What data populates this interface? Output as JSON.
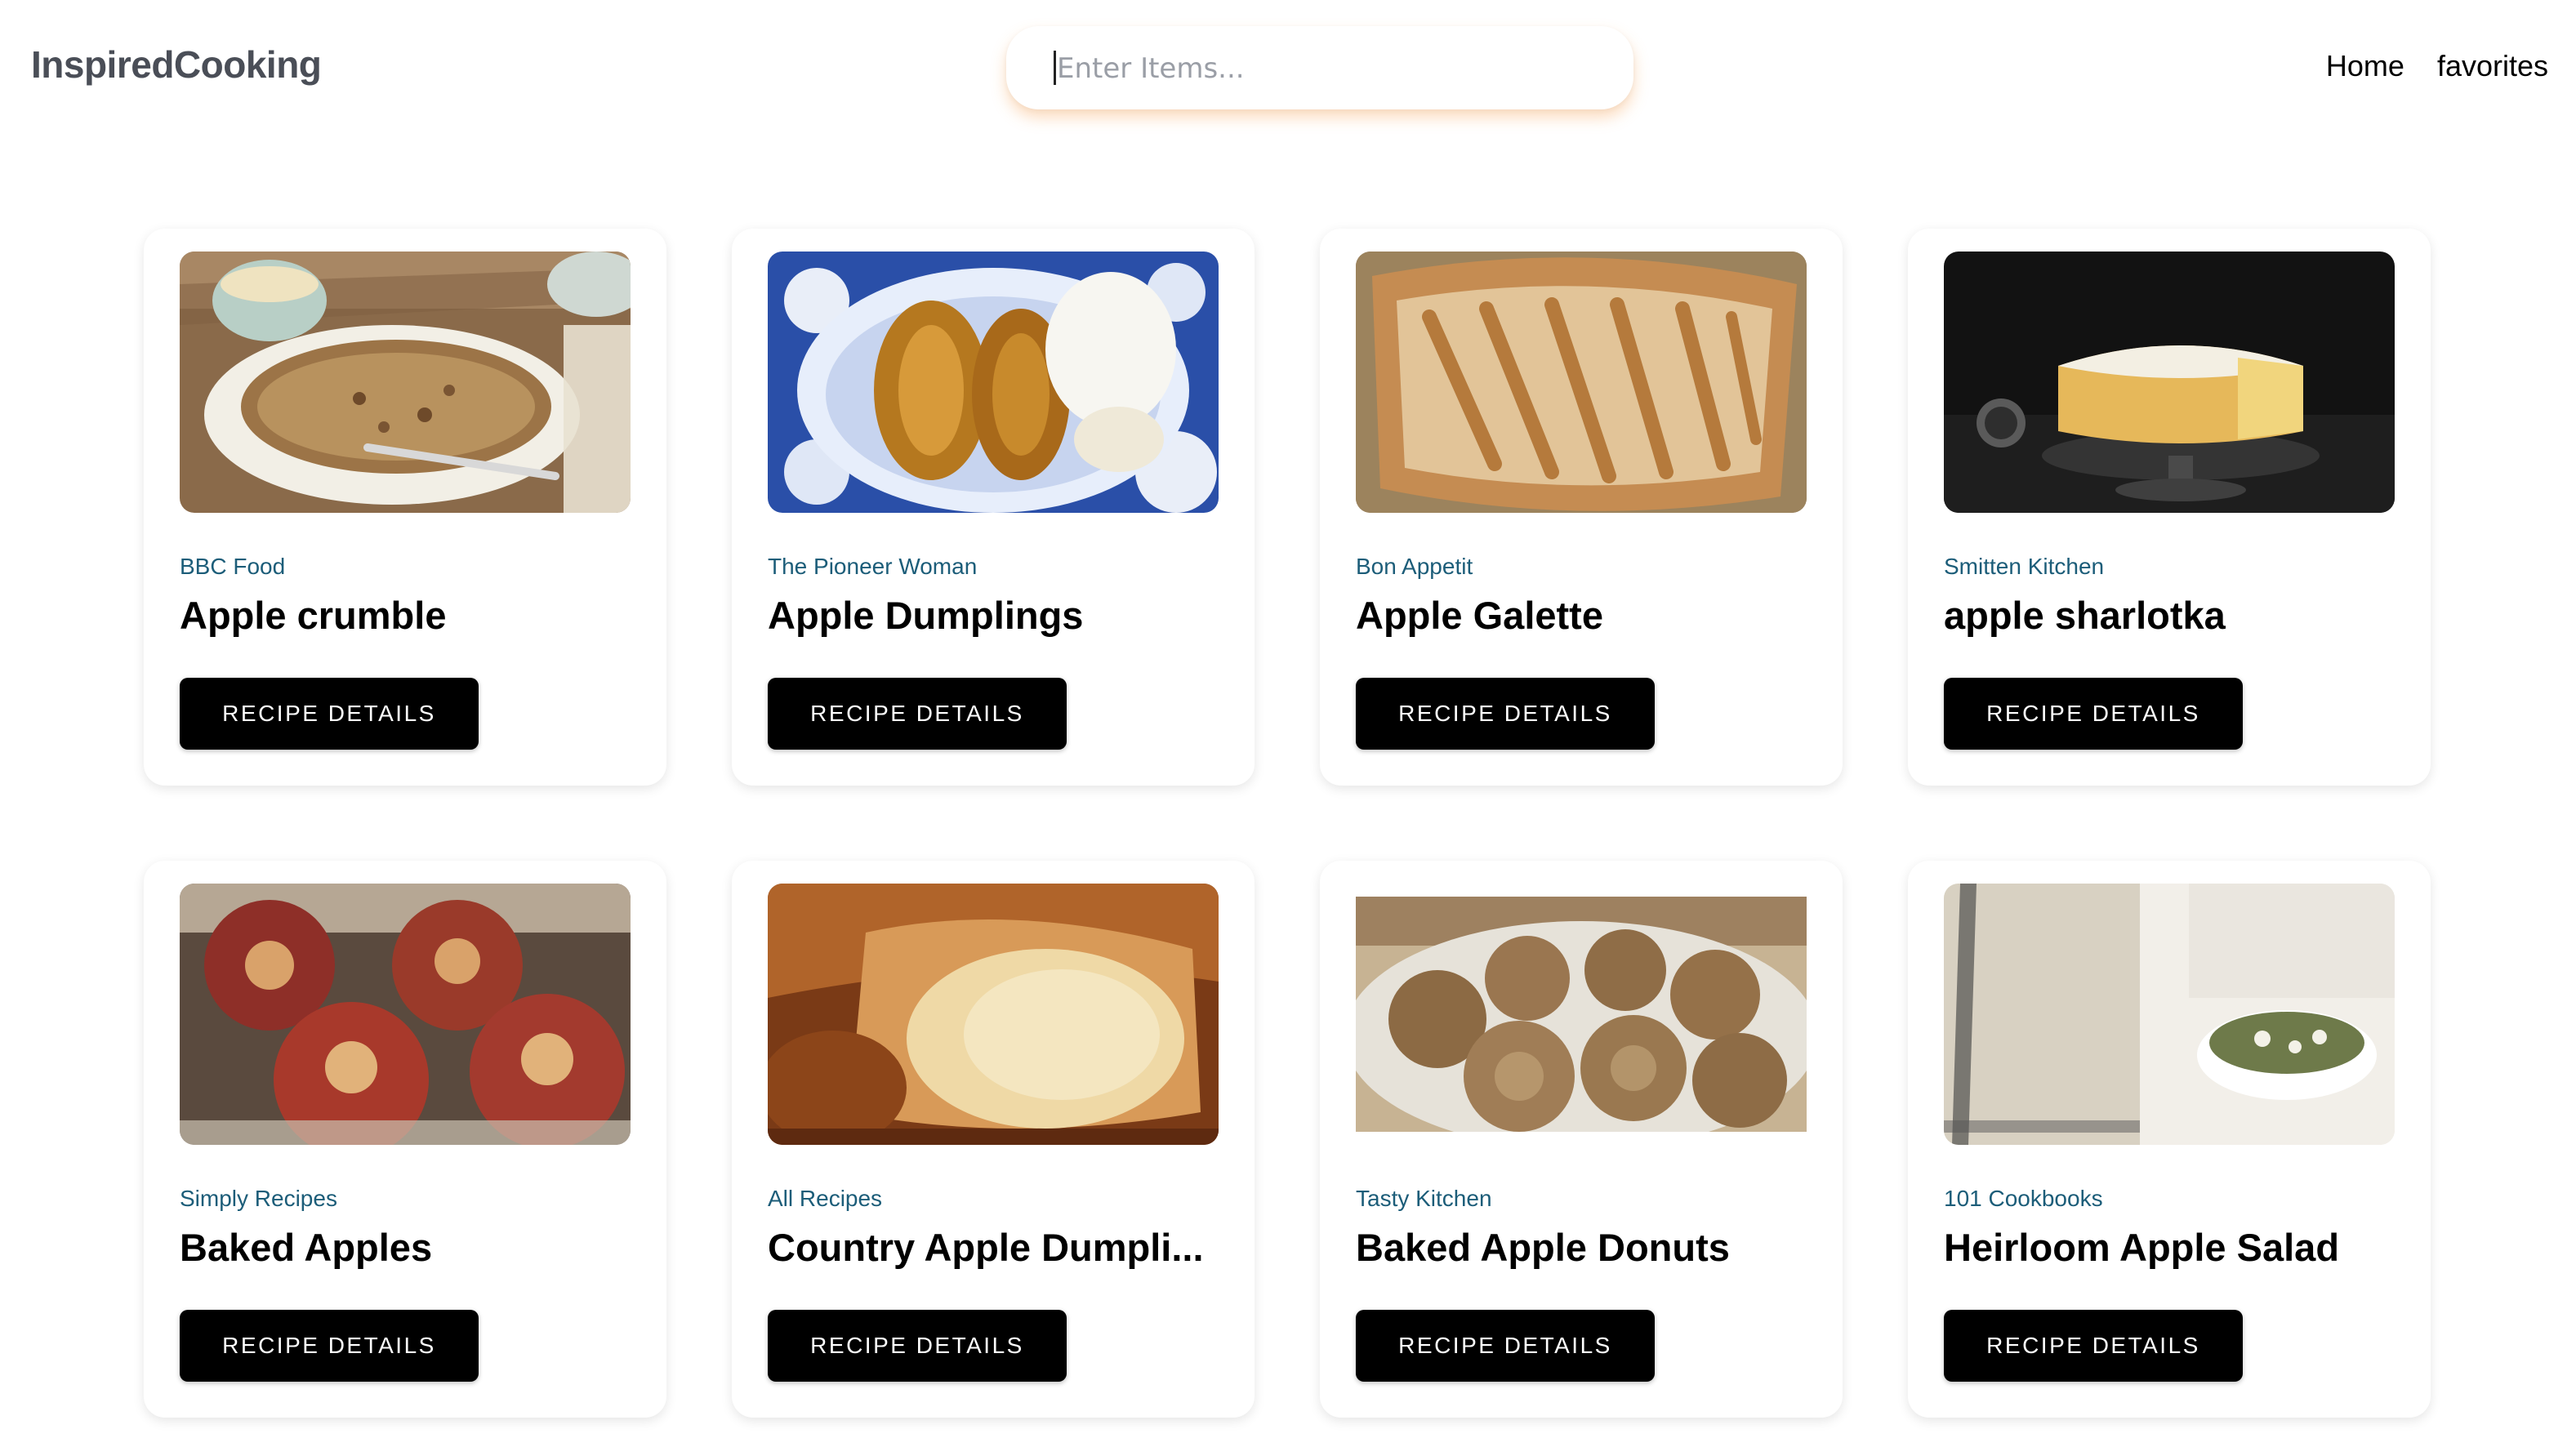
{
  "header": {
    "brand": "InspiredCooking",
    "search_placeholder": "Enter Items...",
    "nav": [
      "Home",
      "favorites"
    ]
  },
  "recipes": [
    {
      "source": "BBC Food",
      "title": "Apple crumble",
      "button": "RECIPE DETAILS",
      "image": "apple-crumble-image"
    },
    {
      "source": "The Pioneer Woman",
      "title": "Apple Dumplings",
      "button": "RECIPE DETAILS",
      "image": "apple-dumplings-image"
    },
    {
      "source": "Bon Appetit",
      "title": "Apple Galette",
      "button": "RECIPE DETAILS",
      "image": "apple-galette-image"
    },
    {
      "source": "Smitten Kitchen",
      "title": "apple sharlotka",
      "button": "RECIPE DETAILS",
      "image": "apple-sharlotka-image"
    },
    {
      "source": "Simply Recipes",
      "title": "Baked Apples",
      "button": "RECIPE DETAILS",
      "image": "baked-apples-image"
    },
    {
      "source": "All Recipes",
      "title": "Country Apple Dumpli...",
      "button": "RECIPE DETAILS",
      "image": "country-apple-dumplings-image"
    },
    {
      "source": "Tasty Kitchen",
      "title": "Baked Apple Donuts",
      "button": "RECIPE DETAILS",
      "image": "baked-apple-donuts-image"
    },
    {
      "source": "101 Cookbooks",
      "title": "Heirloom Apple Salad",
      "button": "RECIPE DETAILS",
      "image": "heirloom-apple-salad-image"
    }
  ],
  "colors": {
    "brand": "#4a4e57",
    "source": "#1c5d79",
    "button_bg": "#000000",
    "search_glow": "#f9b270"
  }
}
